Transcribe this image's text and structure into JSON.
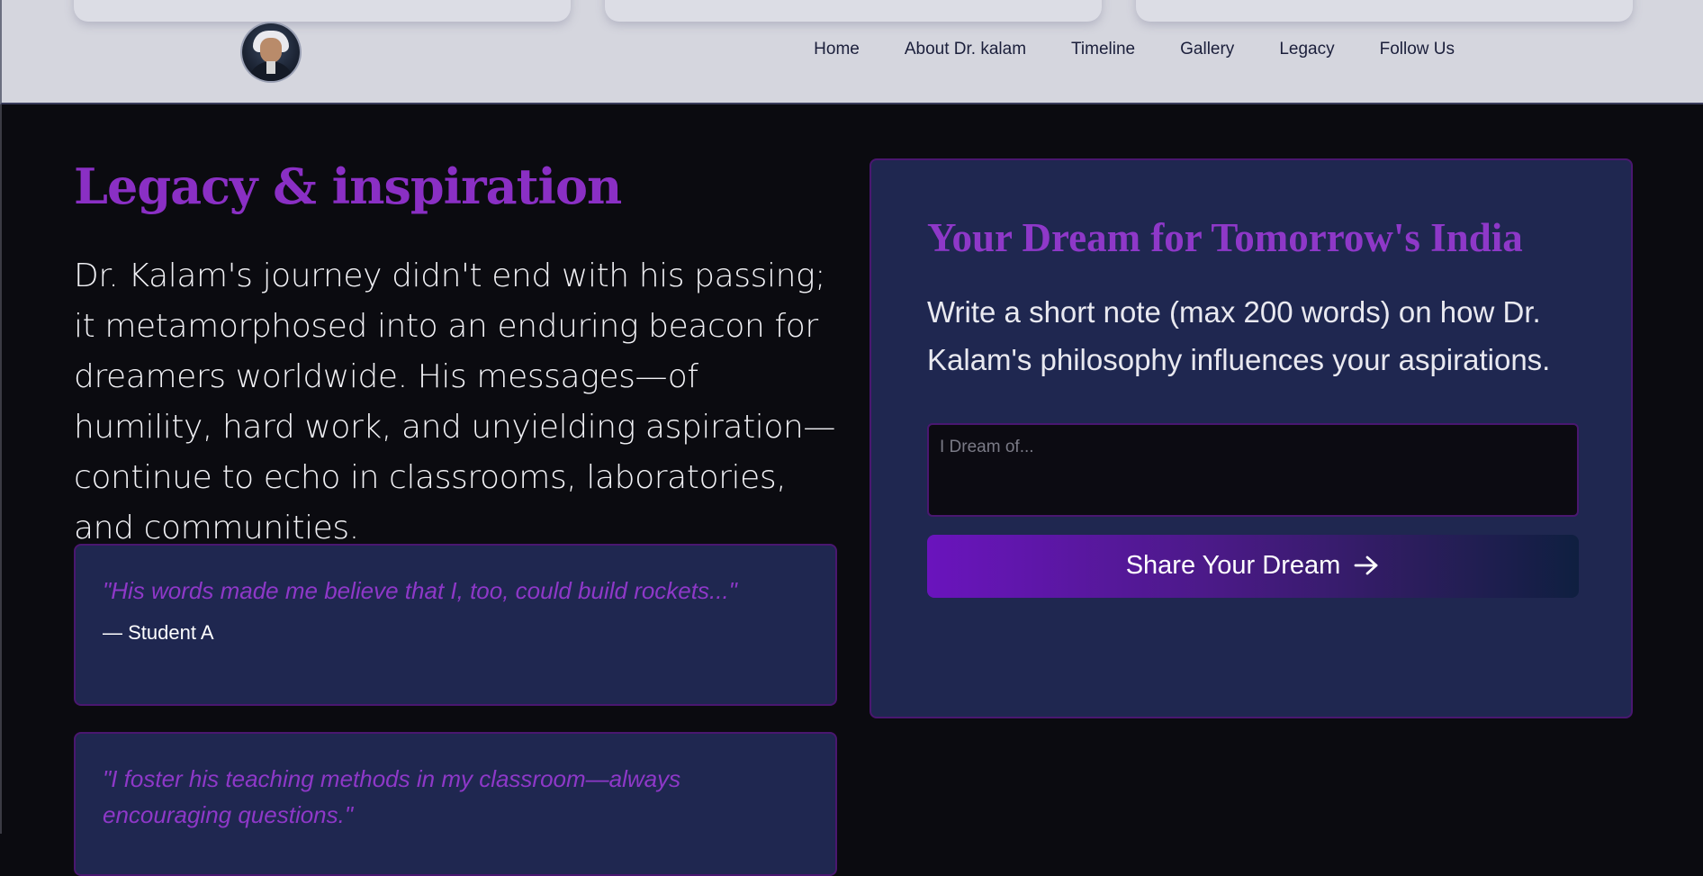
{
  "header": {
    "nav": {
      "home": "Home",
      "about": "About Dr. kalam",
      "timeline": "Timeline",
      "gallery": "Gallery",
      "legacy": "Legacy",
      "follow": "Follow Us"
    }
  },
  "legacy": {
    "title": "Legacy & inspiration",
    "intro": "Dr. Kalam's journey didn't end with his passing; it metamorphosed into an enduring beacon for dreamers worldwide. His messages—of humility, hard work, and unyielding aspiration—continue to echo in classrooms, laboratories, and communities.",
    "quotes": [
      {
        "text": "\"His words made me believe that I, too, could build rockets...\"",
        "author": "— Student A"
      },
      {
        "text": "\"I foster his teaching methods in my classroom—always encouraging questions.\""
      }
    ]
  },
  "dream": {
    "title": "Your Dream for Tomorrow's India",
    "description": "Write a short note (max 200 words) on how Dr. Kalam's philosophy influences your aspirations.",
    "input_placeholder": "I Dream of...",
    "input_value": "",
    "button_label": "Share Your Dream",
    "button_icon": "arrow-right-icon"
  },
  "colors": {
    "accent": "#8e38c8",
    "card_bg": "#1f2750",
    "header_bg": "#d5d6de",
    "page_bg": "#0b0b10"
  }
}
